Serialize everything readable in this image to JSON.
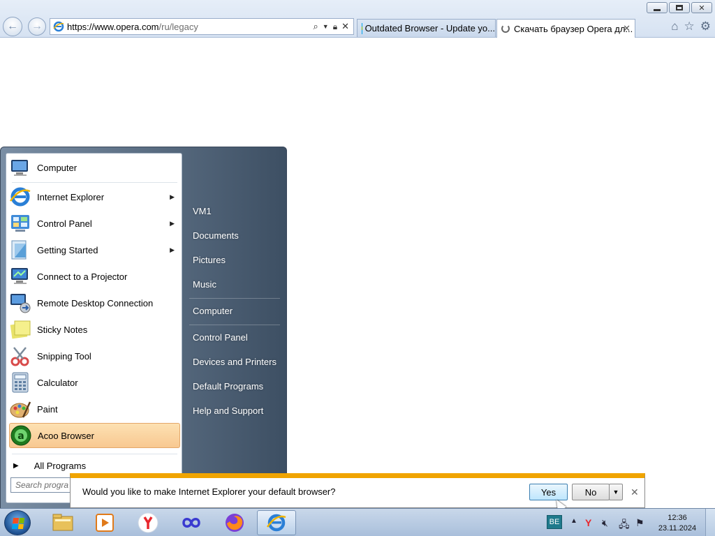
{
  "browser": {
    "address": {
      "scheme": "https://",
      "host": "www.opera.com",
      "path": "/ru/legacy"
    },
    "tabs": [
      {
        "label": "Outdated Browser - Update yo..."
      },
      {
        "label": "Скачать браузер Opera дл..."
      }
    ]
  },
  "start_menu": {
    "pinned": [
      {
        "label": "Computer",
        "icon": "computer-icon",
        "color": "#3a6fb0"
      },
      {
        "label": "Internet Explorer",
        "icon": "internet-explorer-icon",
        "color": "#2a7fd6",
        "submenu": true
      },
      {
        "label": "Control Panel",
        "icon": "control-panel-icon",
        "color": "#3f8bd8",
        "submenu": true
      },
      {
        "label": "Getting Started",
        "icon": "getting-started-icon",
        "color": "#5aa0d8",
        "submenu": true
      },
      {
        "label": "Connect to a Projector",
        "icon": "projector-icon",
        "color": "#2f6fb8"
      },
      {
        "label": "Remote Desktop Connection",
        "icon": "remote-desktop-icon",
        "color": "#3c72b4"
      },
      {
        "label": "Sticky Notes",
        "icon": "sticky-notes-icon",
        "color": "#e8e26a"
      },
      {
        "label": "Snipping Tool",
        "icon": "snipping-tool-icon",
        "color": "#d84a4a"
      },
      {
        "label": "Calculator",
        "icon": "calculator-icon",
        "color": "#7d9fc4"
      },
      {
        "label": "Paint",
        "icon": "paint-icon",
        "color": "#e0a24b"
      },
      {
        "label": "Acoo Browser",
        "icon": "acoo-browser-icon",
        "color": "#2e9b2e",
        "selected": true
      }
    ],
    "all_programs": "All Programs",
    "search_placeholder": "Search progra",
    "right_links": [
      "VM1",
      "Documents",
      "Pictures",
      "Music",
      "Computer",
      "Control Panel",
      "Devices and Printers",
      "Default Programs",
      "Help and Support"
    ]
  },
  "notification": {
    "message": "Would you like to make Internet Explorer your default browser?",
    "yes_label": "Yes",
    "no_label": "No"
  },
  "taskbar": {
    "apps": [
      {
        "name": "file-explorer-icon"
      },
      {
        "name": "media-player-icon"
      },
      {
        "name": "yandex-browser-icon"
      },
      {
        "name": "infinity-app-icon"
      },
      {
        "name": "firefox-icon"
      },
      {
        "name": "internet-explorer-taskbar-icon",
        "active": true
      }
    ],
    "language": "BE",
    "time": "12:36",
    "date": "23.11.2024"
  }
}
